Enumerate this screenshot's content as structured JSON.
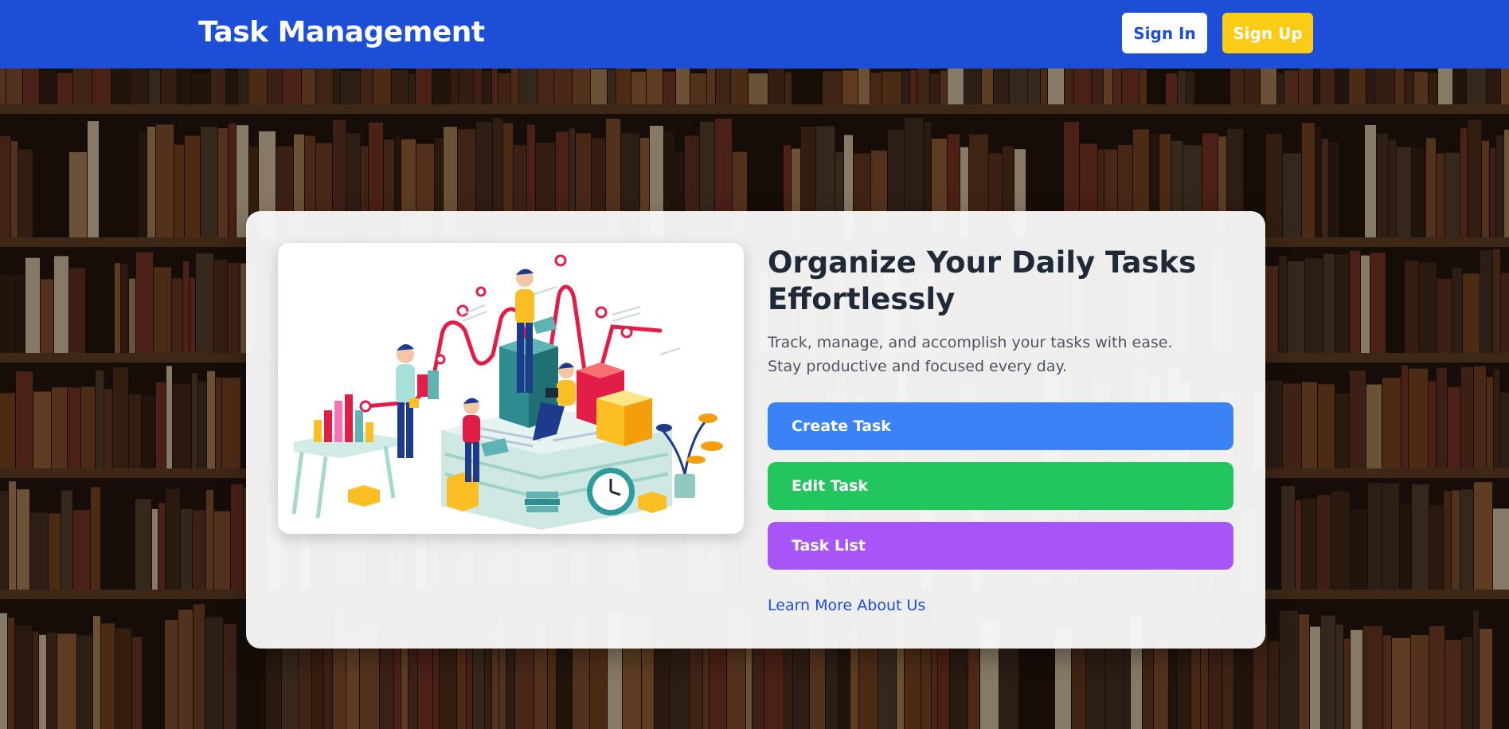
{
  "header": {
    "brand": "Task Management",
    "signin_label": "Sign In",
    "signup_label": "Sign Up"
  },
  "hero": {
    "headline": "Organize Your Daily Tasks Effortlessly",
    "subtext": "Track, manage, and accomplish your tasks with ease. Stay productive and focused every day.",
    "actions": [
      {
        "label": "Create Task",
        "color": "#3b82f6"
      },
      {
        "label": "Edit Task",
        "color": "#22c55e"
      },
      {
        "label": "Task List",
        "color": "#a855f7"
      }
    ],
    "learn_more": "Learn More About Us"
  },
  "colors": {
    "navbar": "#1d4ed8",
    "signup": "#facc15",
    "text_dark": "#1f2937",
    "text_muted": "#4b5563"
  },
  "icons": {
    "illustration": "team-working-on-tasks-illustration",
    "background": "library-bookshelf-background"
  }
}
